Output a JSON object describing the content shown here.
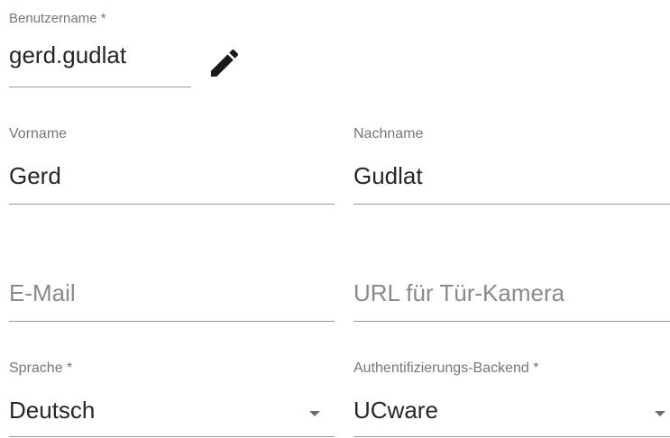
{
  "username": {
    "label": "Benutzername *",
    "value": "gerd.gudlat"
  },
  "first_name": {
    "label": "Vorname",
    "value": "Gerd"
  },
  "last_name": {
    "label": "Nachname",
    "value": "Gudlat"
  },
  "email": {
    "placeholder": "E-Mail"
  },
  "door_camera_url": {
    "placeholder": "URL für Tür-Kamera"
  },
  "language": {
    "label": "Sprache *",
    "selected": "Deutsch"
  },
  "auth_backend": {
    "label": "Authentifizierungs-Backend *",
    "selected": "UCware"
  },
  "icons": {
    "edit": "pencil-icon",
    "dropdown": "dropdown-arrow-icon"
  },
  "colors": {
    "label": "#777777",
    "value": "#262626",
    "placeholder": "#8a8a8a",
    "underline": "#9a9a9a",
    "icon": "#1a1a1a"
  }
}
